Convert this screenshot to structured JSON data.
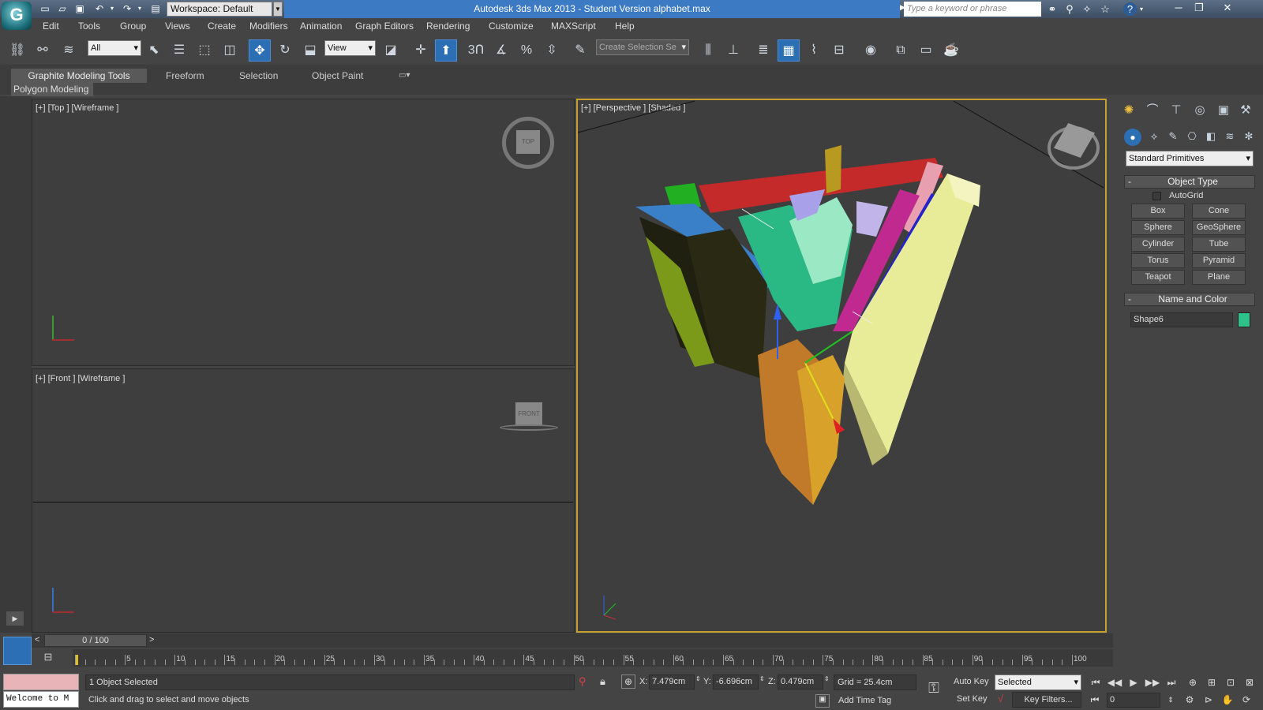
{
  "titlebar": {
    "title": "Autodesk 3ds Max  2013  - Student Version    alphabet.max",
    "workspace": "Workspace: Default",
    "search_placeholder": "Type a keyword or phrase",
    "logo": "G"
  },
  "menu": [
    "Edit",
    "Tools",
    "Group",
    "Views",
    "Create",
    "Modifiers",
    "Animation",
    "Graph Editors",
    "Rendering",
    "Customize",
    "MAXScript",
    "Help"
  ],
  "toolbar": {
    "filter_dropdown": "All",
    "refcoord_dropdown": "View",
    "selection_set": "Create Selection Se",
    "percent_snap_label": "%",
    "snap_label": "3"
  },
  "ribbon": {
    "tabs": [
      "Graphite Modeling Tools",
      "Freeform",
      "Selection",
      "Object Paint"
    ],
    "sub": "Polygon Modeling"
  },
  "viewports": {
    "top": {
      "label": "[+] [Top ] [Wireframe ]",
      "cube": "TOP"
    },
    "front": {
      "label": "[+] [Front ] [Wireframe ]",
      "cube": "FRONT"
    },
    "perspective": {
      "label": "[+] [Perspective ] [Shaded ]"
    }
  },
  "command_panel": {
    "category_dropdown": "Standard Primitives",
    "object_type_header": "Object Type",
    "autogrid_label": "AutoGrid",
    "buttons": [
      "Box",
      "Cone",
      "Sphere",
      "GeoSphere",
      "Cylinder",
      "Tube",
      "Torus",
      "Pyramid",
      "Teapot",
      "Plane"
    ],
    "name_color_header": "Name and Color",
    "object_name": "Shape6",
    "object_color": "#2ec28a"
  },
  "timeline": {
    "frame_counter": "0 / 100",
    "ticks": [
      "5",
      "10",
      "15",
      "20",
      "25",
      "30",
      "35",
      "40",
      "45",
      "50",
      "55",
      "60",
      "65",
      "70",
      "75",
      "80",
      "85",
      "90",
      "95",
      "100"
    ]
  },
  "statusbar": {
    "selection": "1 Object Selected",
    "prompt": "Click and drag to select and move objects",
    "maxscript_listener": "Welcome to M",
    "x_label": "X:",
    "x_value": "7.479cm",
    "y_label": "Y:",
    "y_value": "-6.696cm",
    "z_label": "Z:",
    "z_value": "0.479cm",
    "grid": "Grid = 25.4cm",
    "add_time_tag": "Add Time Tag",
    "auto_key": "Auto Key",
    "set_key": "Set Key",
    "key_mode": "Selected",
    "key_filters": "Key Filters...",
    "current_frame": "0"
  },
  "colors": {
    "accent": "#3c7ac3",
    "active_viewport_border": "#c8a030",
    "listener_bg": "#e8b4b8"
  }
}
